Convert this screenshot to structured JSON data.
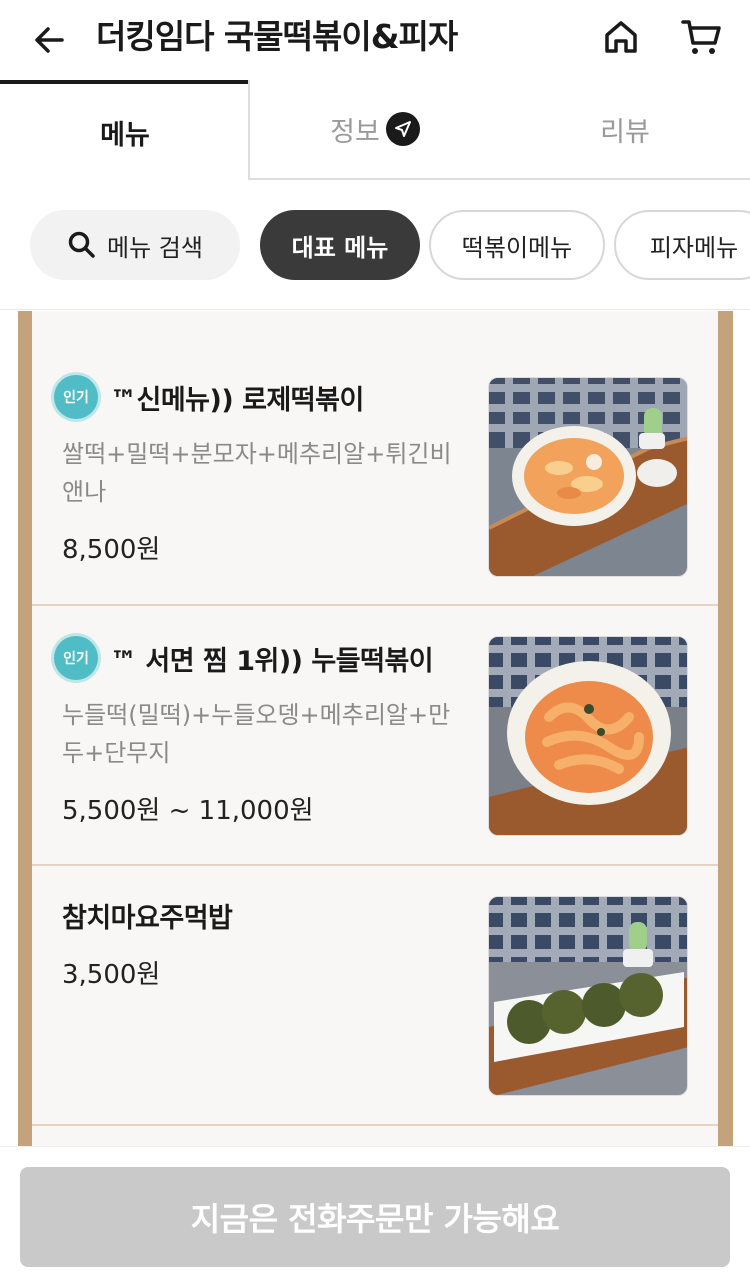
{
  "header": {
    "title": "더킹임다 국물떡볶이&피자",
    "back_icon": "arrow-left-icon",
    "home_icon": "home-icon",
    "cart_icon": "cart-icon"
  },
  "tabs": [
    {
      "label": "메뉴",
      "active": true
    },
    {
      "label": "정보",
      "icon": "paper-plane-icon"
    },
    {
      "label": "리뷰"
    }
  ],
  "chips": {
    "search_label": "메뉴 검색",
    "items": [
      {
        "label": "대표 메뉴",
        "selected": true
      },
      {
        "label": "떡볶이메뉴"
      },
      {
        "label": "피자메뉴"
      }
    ]
  },
  "menu_items": [
    {
      "badge": "인기",
      "name": "™신메뉴)) 로제떡볶이",
      "desc_line1": "쌀떡+밀떡+분모자+메추리알+튀긴비",
      "desc_line2": "앤나",
      "price": "8,500원"
    },
    {
      "badge": "인기",
      "name": "™ 서면 찜 1위)) 누들떡볶이",
      "desc_line1": "누들떡(밀떡)+누들오뎅+메추리알+만",
      "desc_line2": "두+단무지",
      "price": "5,500원 ~ 11,000원"
    },
    {
      "name": "참치마요주먹밥",
      "price": "3,500원"
    }
  ],
  "bottom": {
    "order_label": "지금은 전화주문만 가능해요"
  },
  "colors": {
    "badge": "#4fbcc6",
    "featured_chip": "#3a3a3a",
    "board_frame": "#c4a27c",
    "disabled_button": "#c9c9c9"
  }
}
